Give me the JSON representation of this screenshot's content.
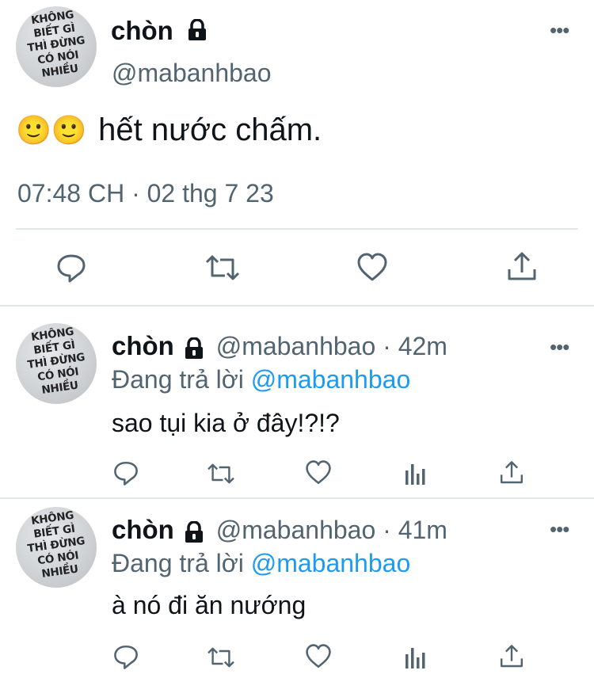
{
  "main_tweet": {
    "display_name": "chòn",
    "handle": "@mabanhbao",
    "text": "hết nước chấm.",
    "emoji": "🙂🙂",
    "timestamp": "07:48 CH · 02 thg 7 23",
    "avatar_text": [
      "KHÔNG",
      "BIẾT GÌ",
      "THÌ ĐỪNG",
      "CÓ NÓI",
      "NHIỀU"
    ]
  },
  "replies": [
    {
      "display_name": "chòn",
      "handle_time": "@mabanhbao · 42m",
      "replying_label": "Đang trả lời",
      "replying_to": "@mabanhbao",
      "text": "sao tụi kia ở đây!?!?"
    },
    {
      "display_name": "chòn",
      "handle_time": "@mabanhbao · 41m",
      "replying_label": "Đang trả lời",
      "replying_to": "@mabanhbao",
      "text": "à nó đi ăn nướng"
    }
  ],
  "more_label": "•••",
  "colors": {
    "text": "#0f1419",
    "secondary": "#536471",
    "accent": "#1d9bf0",
    "divider": "#e3e6e8"
  },
  "icons": [
    "reply-icon",
    "retweet-icon",
    "like-icon",
    "share-icon",
    "views-icon",
    "lock-icon",
    "more-icon"
  ]
}
